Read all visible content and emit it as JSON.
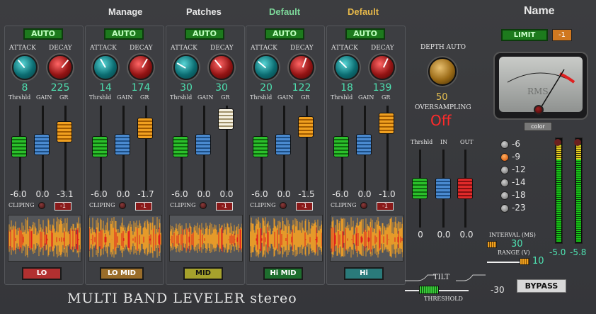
{
  "header": {
    "manage": "Manage",
    "patches": "Patches",
    "default1": "Default",
    "default2": "Default",
    "name": "Name"
  },
  "bands": [
    {
      "auto": "AUTO",
      "attack_label": "ATTACK",
      "decay_label": "DECAY",
      "attack": "8",
      "decay": "225",
      "thr_label": "Thrshld",
      "gain_label": "GAIN",
      "gr_label": "GR",
      "thr": "-6.0",
      "gain": "0.0",
      "gr": "-3.1",
      "clip": "CLIPING",
      "minus": "-1",
      "name": "LO",
      "color": "#b23030"
    },
    {
      "auto": "AUTO",
      "attack_label": "ATTACK",
      "decay_label": "DECAY",
      "attack": "14",
      "decay": "174",
      "thr_label": "Thrshld",
      "gain_label": "GAIN",
      "gr_label": "GR",
      "thr": "-6.0",
      "gain": "0.0",
      "gr": "-1.7",
      "clip": "CLIPING",
      "minus": "-1",
      "name": "LO MID",
      "color": "#9a6d2a"
    },
    {
      "auto": "AUTO",
      "attack_label": "ATTACK",
      "decay_label": "DECAY",
      "attack": "30",
      "decay": "30",
      "thr_label": "Thrshld",
      "gain_label": "GAIN",
      "gr_label": "GR",
      "thr": "-6.0",
      "gain": "0.0",
      "gr": "0.0",
      "clip": "CLIPING",
      "minus": "-1",
      "name": "MID",
      "color": "#a6a22c"
    },
    {
      "auto": "AUTO",
      "attack_label": "ATTACK",
      "decay_label": "DECAY",
      "attack": "20",
      "decay": "122",
      "thr_label": "Thrshld",
      "gain_label": "GAIN",
      "gr_label": "GR",
      "thr": "-6.0",
      "gain": "0.0",
      "gr": "-1.5",
      "clip": "CLIPING",
      "minus": "-1",
      "name": "Hi MID",
      "color": "#1e6e2e"
    },
    {
      "auto": "AUTO",
      "attack_label": "ATTACK",
      "decay_label": "DECAY",
      "attack": "18",
      "decay": "139",
      "thr_label": "Thrshld",
      "gain_label": "GAIN",
      "gr_label": "GR",
      "thr": "-6.0",
      "gain": "0.0",
      "gr": "-1.0",
      "clip": "CLIPING",
      "minus": "-1",
      "name": "Hi",
      "color": "#2a7a7a"
    }
  ],
  "depth": {
    "label": "DEPTH AUTO",
    "value": "50",
    "oversampling_label": "OVERSAMPLING",
    "oversampling": "Off",
    "thr_label": "Thrshld",
    "in_label": "IN",
    "out_label": "OUT",
    "thr": "0",
    "in": "0.0",
    "out": "0.0"
  },
  "limiter": {
    "limit": "LIMIT",
    "minus": "-1",
    "rms": "RMS",
    "color": "color",
    "scale": [
      "-20",
      "-10",
      "-7",
      "-5",
      "-3",
      "-2",
      "-1",
      "0",
      "+1",
      "+2",
      "+3"
    ]
  },
  "range_options": [
    "-6",
    "-9",
    "-12",
    "-14",
    "-18",
    "-23"
  ],
  "range_selected": "-9",
  "interval": {
    "label": "INTERVAL (MS)",
    "value": "30"
  },
  "range_v": {
    "label": "RANGE (V)",
    "value": "10"
  },
  "meters": {
    "left": "-5.0",
    "right": "-5.8"
  },
  "footer": {
    "title": "MULTI BAND LEVELER stereo",
    "tilt": "TILT",
    "threshold": "THRESHOLD",
    "threshold_value": "-30",
    "bypass": "BYPASS"
  },
  "colors": {
    "teal_value": "#4ee0b0",
    "oversampling_off": "#ff2a2a",
    "default1": "#7dd89a",
    "default2": "#e6b84a"
  }
}
